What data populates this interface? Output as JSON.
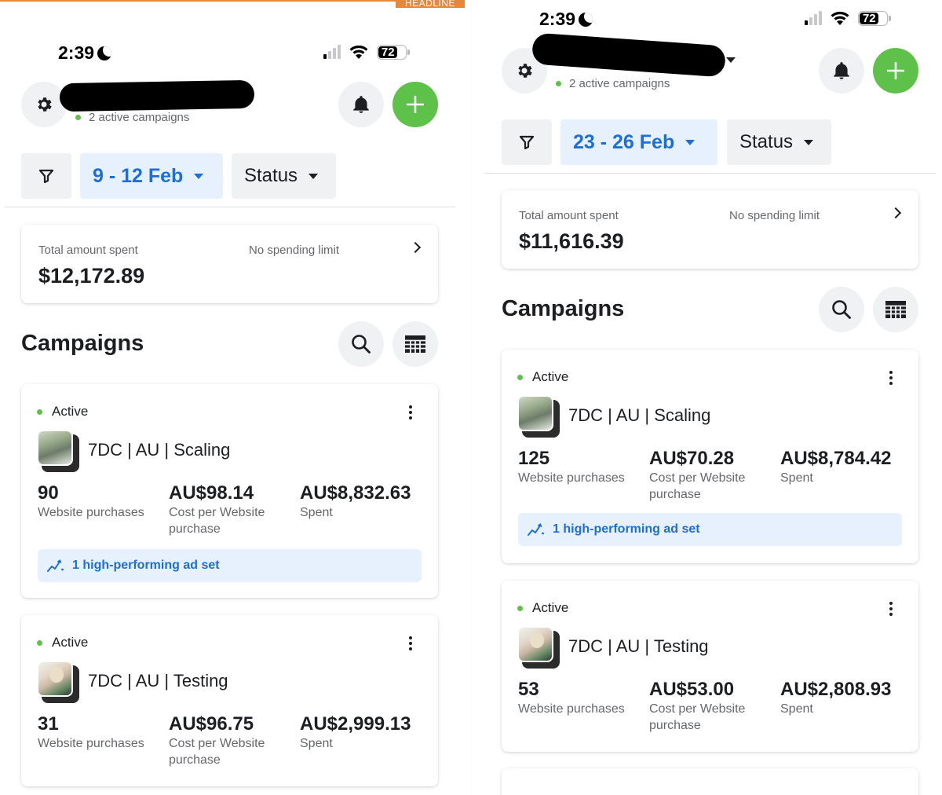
{
  "banner": {
    "label": "HEADLINE"
  },
  "screens": [
    {
      "status_bar": {
        "time": "2:39",
        "battery": "72"
      },
      "header": {
        "active_campaigns": "2 active campaigns"
      },
      "filters": {
        "date_range": "9 - 12 Feb",
        "status": "Status"
      },
      "spend": {
        "label": "Total amount spent",
        "amount": "$12,172.89",
        "limit": "No spending limit"
      },
      "section_title": "Campaigns",
      "campaigns": [
        {
          "status": "Active",
          "name": "7DC | AU | Scaling",
          "metrics": [
            {
              "value": "90",
              "label": "Website purchases"
            },
            {
              "value": "AU$98.14",
              "label": "Cost per Website purchase"
            },
            {
              "value": "AU$8,832.63",
              "label": "Spent"
            }
          ],
          "insight": "1 high-performing ad set"
        },
        {
          "status": "Active",
          "name": "7DC | AU | Testing",
          "metrics": [
            {
              "value": "31",
              "label": "Website purchases"
            },
            {
              "value": "AU$96.75",
              "label": "Cost per Website purchase"
            },
            {
              "value": "AU$2,999.13",
              "label": "Spent"
            }
          ]
        }
      ]
    },
    {
      "status_bar": {
        "time": "2:39",
        "battery": "72"
      },
      "header": {
        "active_campaigns": "2 active campaigns"
      },
      "filters": {
        "date_range": "23 - 26 Feb",
        "status": "Status"
      },
      "spend": {
        "label": "Total amount spent",
        "amount": "$11,616.39",
        "limit": "No spending limit"
      },
      "section_title": "Campaigns",
      "campaigns": [
        {
          "status": "Active",
          "name": "7DC | AU | Scaling",
          "metrics": [
            {
              "value": "125",
              "label": "Website purchases"
            },
            {
              "value": "AU$70.28",
              "label": "Cost per Website purchase"
            },
            {
              "value": "AU$8,784.42",
              "label": "Spent"
            }
          ],
          "insight": "1 high-performing ad set"
        },
        {
          "status": "Active",
          "name": "7DC | AU | Testing",
          "metrics": [
            {
              "value": "53",
              "label": "Website purchases"
            },
            {
              "value": "AU$53.00",
              "label": "Cost per Website purchase"
            },
            {
              "value": "AU$2,808.93",
              "label": "Spent"
            }
          ]
        }
      ]
    }
  ]
}
